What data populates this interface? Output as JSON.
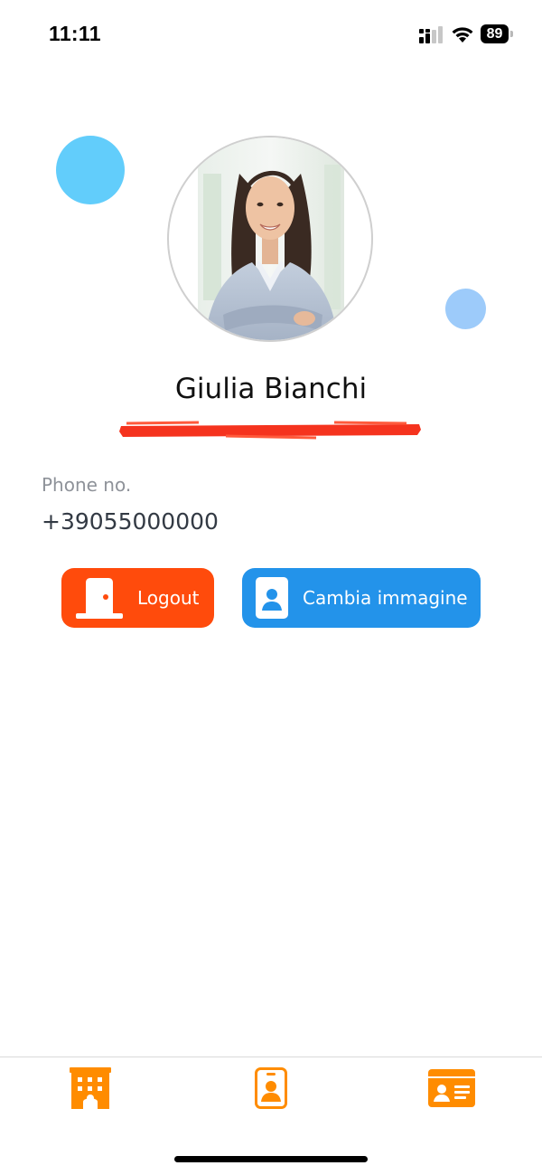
{
  "status_bar": {
    "time": "11:11",
    "battery_level": "89",
    "icons": [
      "signal-icon",
      "wifi-icon",
      "battery-icon"
    ]
  },
  "profile": {
    "name": "Giulia Bianchi",
    "avatar_icon": "profile-photo"
  },
  "phone": {
    "label": "Phone no.",
    "value": "+39055000000"
  },
  "actions": {
    "logout_label": "Logout",
    "logout_icon": "door-icon",
    "change_image_label": "Cambia immagine",
    "change_image_icon": "badge-user-icon"
  },
  "bottom_nav": {
    "items": [
      {
        "icon": "hotel-icon"
      },
      {
        "icon": "badge-user-icon"
      },
      {
        "icon": "id-card-icon"
      }
    ]
  },
  "colors": {
    "logout_button": "#ff4b0c",
    "change_image_button": "#2393ea",
    "nav_icons": "#ff8c00",
    "bubble_big": "#62cdfb",
    "bubble_small": "#9dcbfa"
  }
}
